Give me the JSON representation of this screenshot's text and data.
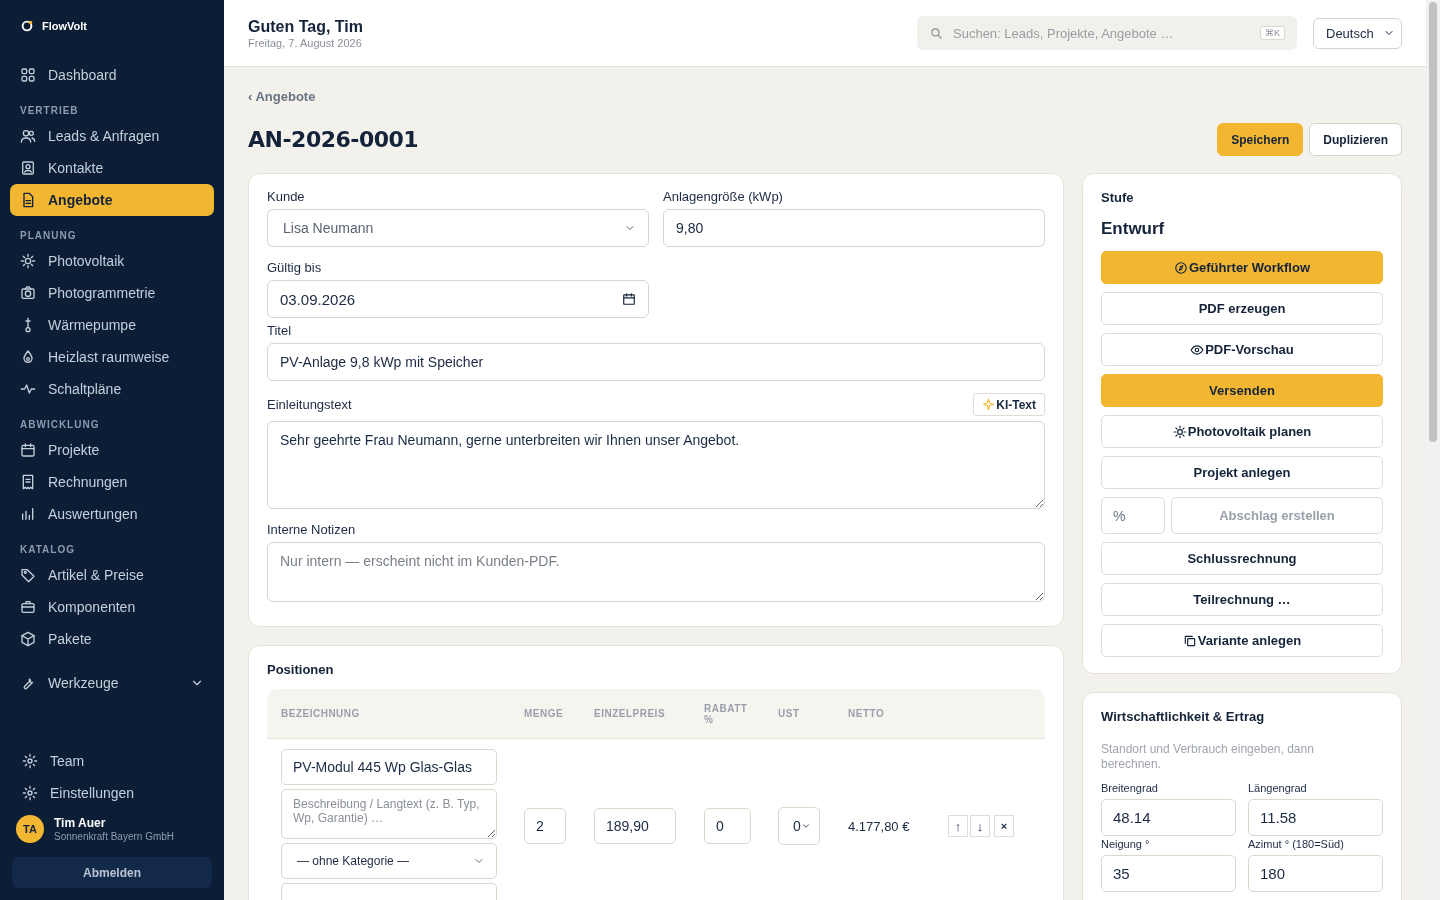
{
  "app_name": "FlowVolt",
  "sidebar": {
    "sections": [
      {
        "items": [
          {
            "label": "Dashboard",
            "selected": false
          }
        ]
      },
      {
        "heading": "VERTRIEB",
        "items": [
          {
            "label": "Leads & Anfragen",
            "selected": false
          },
          {
            "label": "Kontakte",
            "selected": false
          },
          {
            "label": "Angebote",
            "selected": true
          }
        ]
      },
      {
        "heading": "PLANUNG",
        "items": [
          {
            "label": "Photovoltaik",
            "selected": false
          },
          {
            "label": "Photogrammetrie",
            "selected": false
          },
          {
            "label": "Wärmepumpe",
            "selected": false
          },
          {
            "label": "Heizlast raumweise",
            "selected": false
          },
          {
            "label": "Schaltpläne",
            "selected": false
          }
        ]
      },
      {
        "heading": "ABWICKLUNG",
        "items": [
          {
            "label": "Projekte",
            "selected": false
          },
          {
            "label": "Rechnungen",
            "selected": false
          },
          {
            "label": "Auswertungen",
            "selected": false
          }
        ]
      },
      {
        "heading": "KATALOG",
        "items": [
          {
            "label": "Artikel & Preise",
            "selected": false
          },
          {
            "label": "Komponenten",
            "selected": false
          },
          {
            "label": "Pakete",
            "selected": false
          }
        ]
      }
    ],
    "tools": {
      "label": "Werkzeuge",
      "expanded": false
    },
    "footer_items": [
      {
        "label": "Team",
        "selected": false
      },
      {
        "label": "Einstellungen",
        "selected": false
      }
    ],
    "user": {
      "initials": "TA",
      "name": "Tim Auer",
      "company": "Sonnenkraft Bayern GmbH"
    },
    "logout": "Abmelden"
  },
  "header": {
    "greeting": "Guten Tag, Tim",
    "date": "Freitag, 7. August 2026",
    "search": {
      "placeholder": "Suchen: Leads, Projekte, Angebote …",
      "shortcut": "⌘K"
    },
    "language": "Deutsch"
  },
  "breadcrumb": "‹ Angebote",
  "title": "AN-2026-0001",
  "actions": [
    {
      "label": "Speichern",
      "kind": "primary"
    },
    {
      "label": "Duplizieren",
      "kind": "secondary"
    }
  ],
  "form": {
    "fields": [
      {
        "label": "Kunde",
        "kind": "select",
        "value": "Lisa Neumann"
      },
      {
        "label": "Anlagengröße (kWp)",
        "kind": "input",
        "value": "9,80"
      },
      {
        "label": "Gültig bis",
        "kind": "date",
        "value": "03.09.2026"
      },
      {
        "label": "Titel",
        "kind": "input",
        "value": "PV-Anlage 9,8 kWp mit Speicher"
      },
      {
        "label": "Einleitungstext",
        "kind": "textarea",
        "value": "Sehr geehrte Frau Neumann, gerne unterbreiten wir Ihnen unser Angebot.",
        "action": "KI-Text"
      },
      {
        "label": "Interne Notizen",
        "kind": "textarea",
        "placeholder": "Nur intern — erscheint nicht im Kunden-PDF."
      }
    ]
  },
  "positions": {
    "title": "Positionen",
    "columns": [
      "BEZEICHNUNG",
      "MENGE",
      "EINZELPREIS",
      "RABATT %",
      "UST",
      "NETTO"
    ],
    "rows": [
      {
        "name": "PV-Modul 445 Wp Glas-Glas",
        "description_placeholder": "Beschreibung / Langtext (z. B. Typ, Wp, Garantie) …",
        "category": "— ohne Kategorie —",
        "quantity": "2",
        "unit_price": "189,90",
        "discount": "0",
        "vat": "0",
        "net": "4.177,80 €",
        "actions": [
          "↑",
          "↓",
          "×"
        ]
      }
    ]
  },
  "stage": {
    "heading": "Stufe",
    "value": "Entwurf",
    "buttons": [
      {
        "label": "Geführter Workflow",
        "kind": "primary"
      },
      {
        "label": "PDF erzeugen",
        "kind": "outline"
      },
      {
        "label": "PDF-Vorschau",
        "kind": "outline"
      },
      {
        "label": "Versenden",
        "kind": "primary"
      },
      {
        "label": "Photovoltaik planen",
        "kind": "outline"
      },
      {
        "label": "Projekt anlegen",
        "kind": "outline"
      },
      {
        "label": "Abschlag erstellen",
        "kind": "percent",
        "placeholder": "%",
        "disabled": true
      },
      {
        "label": "Schlussrechnung",
        "kind": "outline"
      },
      {
        "label": "Teilrechnung …",
        "kind": "outline"
      },
      {
        "label": "Variante anlegen",
        "kind": "outline"
      }
    ]
  },
  "economy": {
    "title": "Wirtschaftlichkeit & Ertrag",
    "hint": "Standort und Verbrauch eingeben, dann berechnen.",
    "fields": [
      {
        "label": "Breitengrad",
        "value": "48.14"
      },
      {
        "label": "Längengrad",
        "value": "11.58"
      },
      {
        "label": "Neigung °",
        "value": "35"
      },
      {
        "label": "Azimut ° (180=Süd)",
        "value": "180"
      }
    ]
  }
}
